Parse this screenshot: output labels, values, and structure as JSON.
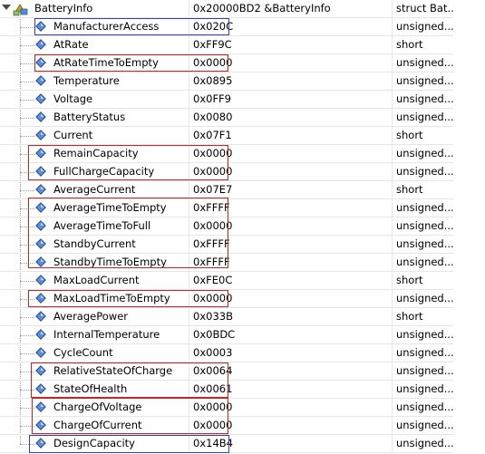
{
  "root": {
    "name": "BatteryInfo",
    "value": "0x20000BD2 &BatteryInfo",
    "type": "struct Bat..."
  },
  "rows": [
    {
      "name": "ManufacturerAccess",
      "value": "0x020C",
      "type": "unsigned..."
    },
    {
      "name": "AtRate",
      "value": "0xFF9C",
      "type": "short"
    },
    {
      "name": "AtRateTimeToEmpty",
      "value": "0x0000",
      "type": "unsigned..."
    },
    {
      "name": "Temperature",
      "value": "0x0895",
      "type": "unsigned..."
    },
    {
      "name": "Voltage",
      "value": "0x0FF9",
      "type": "unsigned..."
    },
    {
      "name": "BatteryStatus",
      "value": "0x0080",
      "type": "unsigned..."
    },
    {
      "name": "Current",
      "value": "0x07F1",
      "type": "short"
    },
    {
      "name": "RemainCapacity",
      "value": "0x0000",
      "type": "unsigned..."
    },
    {
      "name": "FullChargeCapacity",
      "value": "0x0000",
      "type": "unsigned..."
    },
    {
      "name": "AverageCurrent",
      "value": "0x07E7",
      "type": "short"
    },
    {
      "name": "AverageTimeToEmpty",
      "value": "0xFFFF",
      "type": "unsigned..."
    },
    {
      "name": "AverageTimeToFull",
      "value": "0x0000",
      "type": "unsigned..."
    },
    {
      "name": "StandbyCurrent",
      "value": "0xFFFF",
      "type": "unsigned..."
    },
    {
      "name": "StandbyTimeToEmpty",
      "value": "0xFFFF",
      "type": "unsigned..."
    },
    {
      "name": "MaxLoadCurrent",
      "value": "0xFE0C",
      "type": "short"
    },
    {
      "name": "MaxLoadTimeToEmpty",
      "value": "0x0000",
      "type": "unsigned..."
    },
    {
      "name": "AveragePower",
      "value": "0x033B",
      "type": "short"
    },
    {
      "name": "InternalTemperature",
      "value": "0x0BDC",
      "type": "unsigned..."
    },
    {
      "name": "CycleCount",
      "value": "0x0003",
      "type": "unsigned..."
    },
    {
      "name": "RelativeStateOfCharge",
      "value": "0x0064",
      "type": "unsigned..."
    },
    {
      "name": "StateOfHealth",
      "value": "0x0061",
      "type": "unsigned..."
    },
    {
      "name": "ChargeOfVoltage",
      "value": "0x0000",
      "type": "unsigned..."
    },
    {
      "name": "ChargeOfCurrent",
      "value": "0x0000",
      "type": "unsigned..."
    },
    {
      "name": "DesignCapacity",
      "value": "0x14B4",
      "type": "unsigned..."
    }
  ],
  "highlight_colors": {
    "red": "#d21f1f",
    "blue": "#2b3fd1"
  },
  "icons": {
    "root": "struct-variable-icon",
    "leaf": "member-variable-icon",
    "expander": "expanded-triangle-icon"
  }
}
